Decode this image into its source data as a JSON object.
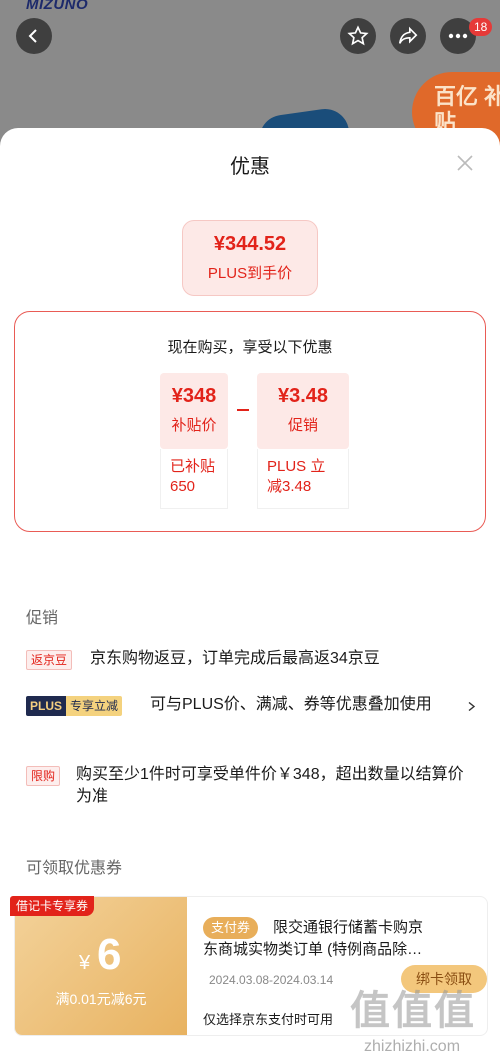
{
  "background": {
    "brand": "MIZUNO",
    "cart_badge": "18",
    "promo_tag": "百亿 补贴"
  },
  "sheet": {
    "title": "优惠",
    "price_pill": {
      "amount": "¥344.52",
      "label": "PLUS到手价"
    },
    "breakdown": {
      "heading": "现在购买，享受以下优惠",
      "items": [
        {
          "value": "¥348",
          "label": "补贴价",
          "note": "已补贴650"
        },
        {
          "value": "¥3.48",
          "label": "促销",
          "note": "PLUS 立减3.48"
        }
      ]
    }
  },
  "promotions": {
    "title": "促销",
    "items": [
      {
        "tag": "返京豆",
        "text": "京东购物返豆，订单完成后最高返34京豆"
      },
      {
        "tag_a": "PLUS",
        "tag_b": "专享立减",
        "text": "可与PLUS价、满减、券等优惠叠加使用"
      },
      {
        "tag": "限购",
        "text": "购买至少1件时可享受单件价￥348，超出数量以结算价为准"
      }
    ]
  },
  "coupons": {
    "title": "可领取优惠券",
    "item": {
      "flag": "借记卡专享券",
      "currency": "¥",
      "amount": "6",
      "condition": "满0.01元减6元",
      "pay_tag": "支付券",
      "desc_line1": "限交通银行储蓄卡购京",
      "desc_line2": "东商城实物类订单 (特例商品除…",
      "date": "2024.03.08-2024.03.14",
      "note": "仅选择京东支付时可用",
      "button": "绑卡领取"
    }
  },
  "watermark": {
    "text": "值值值",
    "url": "zhizhizhi.com"
  },
  "colors": {
    "accent_red": "#e2231a",
    "gold": "#e8ae5a"
  }
}
